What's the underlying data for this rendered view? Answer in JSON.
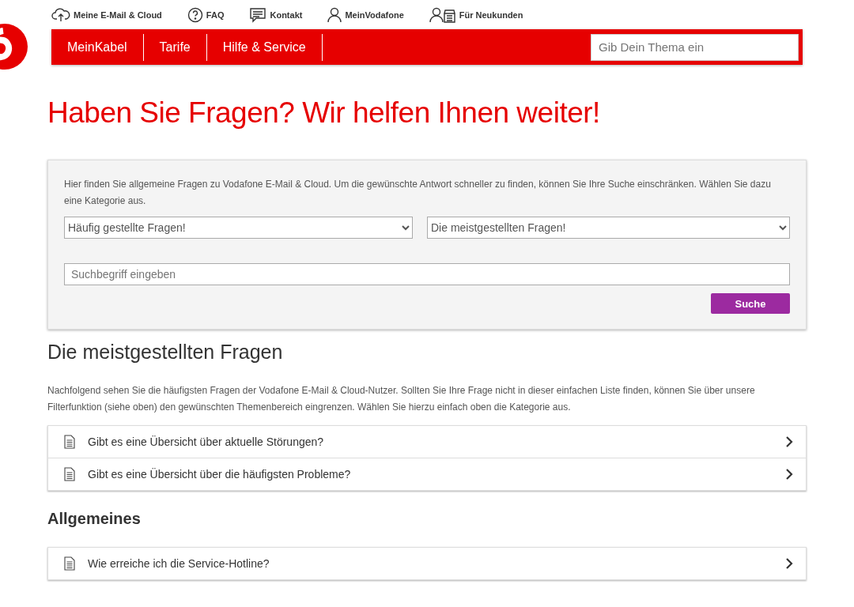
{
  "top_links": [
    {
      "kind": "cloud",
      "label": "Meine E-Mail & Cloud"
    },
    {
      "kind": "help",
      "label": "FAQ"
    },
    {
      "kind": "chat",
      "label": "Kontakt"
    },
    {
      "kind": "person",
      "label": "MeinVodafone"
    },
    {
      "kind": "shop",
      "label": "Für Neukunden"
    }
  ],
  "nav": {
    "items": [
      "MeinKabel",
      "Tarife",
      "Hilfe & Service"
    ],
    "search": {
      "placeholder": "Gib Dein Thema ein"
    }
  },
  "title": "Haben Sie Fragen? Wir helfen Ihnen weiter!",
  "filter": {
    "intro": "Hier finden Sie allgemeine Fragen zu Vodafone E-Mail & Cloud. Um die gewünschte Antwort schneller zu finden, können Sie Ihre Suche einschränken. Wählen Sie dazu eine Kategorie aus.",
    "selects": [
      "Häufig gestellte Fragen!",
      "Die meistgestellten Fragen!"
    ],
    "search": {
      "placeholder": "Suchbegriff eingeben"
    },
    "button": "Suche"
  },
  "sections": [
    {
      "kind": "lead",
      "heading": "Die meistgestellten Fragen",
      "text": "Nachfolgend sehen Sie die häufigsten Fragen der Vodafone E-Mail & Cloud-Nutzer. Sollten Sie Ihre Frage nicht in dieser einfachen Liste finden, können Sie über unsere Filterfunktion (siehe oben) den gewünschten Themenbereich eingrenzen. Wählen Sie hierzu einfach oben die Kategorie aus.",
      "questions": [
        "Gibt es eine Übersicht über aktuelle Störungen?",
        "Gibt es eine Übersicht über die häufigsten Probleme?"
      ]
    },
    {
      "kind": "category",
      "heading": "Allgemeines",
      "questions": [
        "Wie erreiche ich die Service-Hotline?"
      ]
    }
  ]
}
